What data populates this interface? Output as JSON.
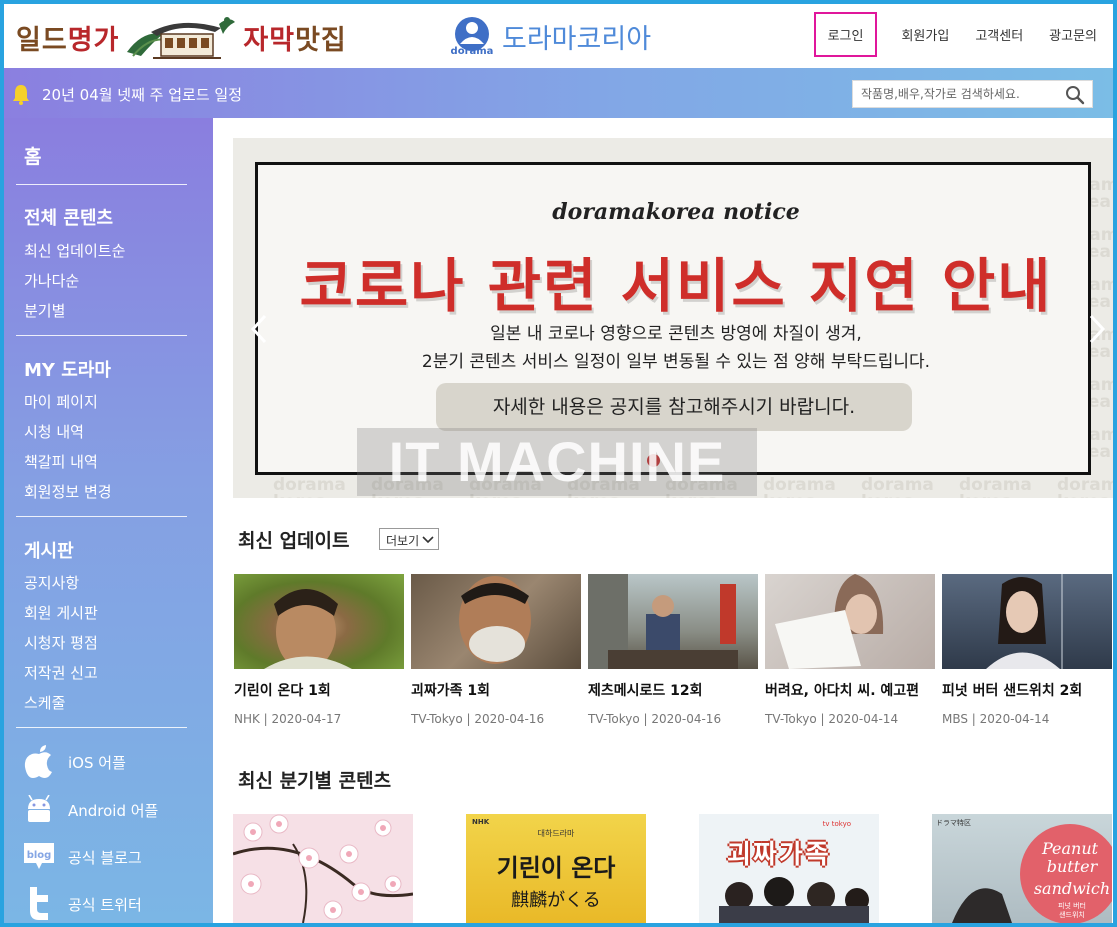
{
  "header": {
    "logo_left_part1": "일드",
    "logo_left_part2": "명가",
    "logo_left_part3": "자막",
    "logo_left_part4": "맛집",
    "logo_right_small": "dorama",
    "logo_right_name": "도라마코리아",
    "nav": [
      "로그인",
      "회원가입",
      "고객센터",
      "광고문의"
    ]
  },
  "bar": {
    "notice": "20년 04월 넷째 주 업로드 일정",
    "search_placeholder": "작품명,배우,작가로 검색하세요."
  },
  "sidebar": {
    "home": "홈",
    "groups": [
      {
        "title": "전체 콘텐츠",
        "items": [
          "최신 업데이트순",
          "가나다순",
          "분기별"
        ]
      },
      {
        "title": "MY 도라마",
        "items": [
          "마이 페이지",
          "시청 내역",
          "책갈피 내역",
          "회원정보 변경"
        ]
      },
      {
        "title": "게시판",
        "items": [
          "공지사항",
          "회원 게시판",
          "시청자 평점",
          "저작권 신고",
          "스케줄"
        ]
      }
    ],
    "apps": [
      {
        "icon": "apple-icon",
        "label": "iOS 어플"
      },
      {
        "icon": "android-icon",
        "label": "Android 어플"
      },
      {
        "icon": "blog-icon",
        "label": "공식 블로그",
        "badge": "blog"
      },
      {
        "icon": "twitter-icon",
        "label": "공식 트위터"
      }
    ]
  },
  "banner": {
    "subtitle": "doramakorea notice",
    "headline": "코로나 관련 서비스 지연 안내",
    "line1": "일본 내 코로나 영향으로 콘텐츠 방영에 차질이 생겨,",
    "line2": "2분기 콘텐츠 서비스 일정이 일부 변동될 수 있는 점 양해 부탁드립니다.",
    "button": "자세한 내용은 공지를 참고해주시기 바랍니다.",
    "bg_text": "dorama korea",
    "watermark": "IT MACHINE"
  },
  "latest": {
    "title": "최신 업데이트",
    "more": "더보기",
    "cards": [
      {
        "title": "기린이 온다 1회",
        "meta": "NHK | 2020-04-17"
      },
      {
        "title": "괴짜가족 1회",
        "meta": "TV-Tokyo | 2020-04-16"
      },
      {
        "title": "제츠메시로드 12회",
        "meta": "TV-Tokyo | 2020-04-16"
      },
      {
        "title": "버려요, 아다치 씨. 예고편",
        "meta": "TV-Tokyo | 2020-04-14"
      },
      {
        "title": "피넛 버터 샌드위치 2회",
        "meta": "MBS | 2020-04-14"
      }
    ]
  },
  "quarterly": {
    "title": "최신 분기별 콘텐츠",
    "posters": [
      {
        "name": "sakura-poster"
      },
      {
        "logo": "NHK",
        "title": "기린이 온다",
        "subtitle_top": "대하드라마",
        "subtitle_jp": "麒麟がくる"
      },
      {
        "logo": "tv tokyo",
        "title": "괴짜가족"
      },
      {
        "corner": "ドラマ特区",
        "line1": "Peanut",
        "line2": "butter",
        "line3": "sandwich",
        "kr1": "피넛 버터",
        "kr2": "샌드위치"
      }
    ]
  },
  "colors": {
    "accent": "#4f8ad9",
    "headline_red": "#cf2e2a",
    "login_highlight": "#e0169b",
    "frame": "#29a3e0"
  }
}
